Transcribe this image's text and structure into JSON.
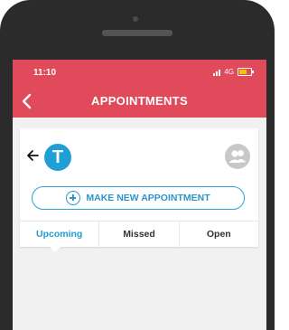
{
  "status_bar": {
    "time": "11:10",
    "network": "4G",
    "icons": [
      "signal-icon",
      "battery-icon"
    ]
  },
  "app_bar": {
    "title": "APPOINTMENTS",
    "back_icon": "chevron-left-icon"
  },
  "profile": {
    "avatar_letter": "T",
    "avatar_color": "#1e9fd6",
    "contacts_icon": "contacts-icon"
  },
  "actions": {
    "make_new_label": "MAKE NEW APPOINTMENT"
  },
  "tabs": [
    {
      "label": "Upcoming",
      "active": true
    },
    {
      "label": "Missed",
      "active": false
    },
    {
      "label": "Open",
      "active": false
    }
  ],
  "colors": {
    "header": "#e04a5a",
    "accent": "#1e9fd6"
  }
}
